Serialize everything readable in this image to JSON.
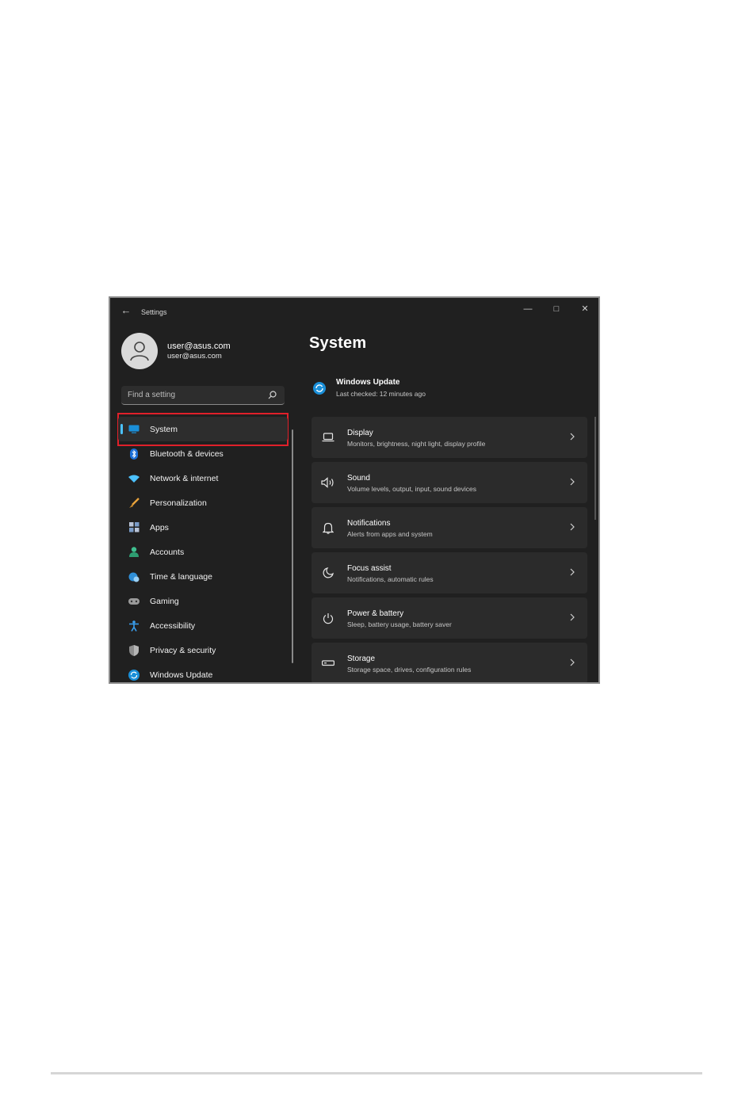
{
  "window": {
    "app_title": "Settings",
    "controls": {
      "minimize": "—",
      "maximize": "□",
      "close": "✕"
    }
  },
  "profile": {
    "name": "user@asus.com",
    "email": "user@asus.com"
  },
  "search": {
    "placeholder": "Find a setting",
    "icon": "search-icon"
  },
  "sidebar": {
    "items": [
      {
        "label": "System",
        "icon": "monitor-icon",
        "active": true
      },
      {
        "label": "Bluetooth & devices",
        "icon": "bluetooth-icon"
      },
      {
        "label": "Network & internet",
        "icon": "wifi-icon"
      },
      {
        "label": "Personalization",
        "icon": "brush-icon"
      },
      {
        "label": "Apps",
        "icon": "apps-icon"
      },
      {
        "label": "Accounts",
        "icon": "person-icon"
      },
      {
        "label": "Time & language",
        "icon": "globe-clock-icon"
      },
      {
        "label": "Gaming",
        "icon": "gamepad-icon"
      },
      {
        "label": "Accessibility",
        "icon": "accessibility-icon"
      },
      {
        "label": "Privacy & security",
        "icon": "shield-icon"
      },
      {
        "label": "Windows Update",
        "icon": "update-icon"
      }
    ]
  },
  "main": {
    "title": "System",
    "update_banner": {
      "title": "Windows Update",
      "subtitle": "Last checked: 12 minutes ago"
    },
    "cards": [
      {
        "title": "Display",
        "subtitle": "Monitors, brightness, night light, display profile",
        "icon": "laptop-icon"
      },
      {
        "title": "Sound",
        "subtitle": "Volume levels, output, input, sound devices",
        "icon": "speaker-icon"
      },
      {
        "title": "Notifications",
        "subtitle": "Alerts from apps and system",
        "icon": "bell-icon"
      },
      {
        "title": "Focus assist",
        "subtitle": "Notifications, automatic rules",
        "icon": "moon-icon"
      },
      {
        "title": "Power & battery",
        "subtitle": "Sleep, battery usage, battery saver",
        "icon": "power-icon"
      },
      {
        "title": "Storage",
        "subtitle": "Storage space, drives, configuration rules",
        "icon": "storage-icon"
      }
    ]
  },
  "colors": {
    "accent": "#4cc2ff",
    "highlight_box": "#e0202a",
    "window_bg": "#202020",
    "card_bg": "#2b2b2b"
  }
}
